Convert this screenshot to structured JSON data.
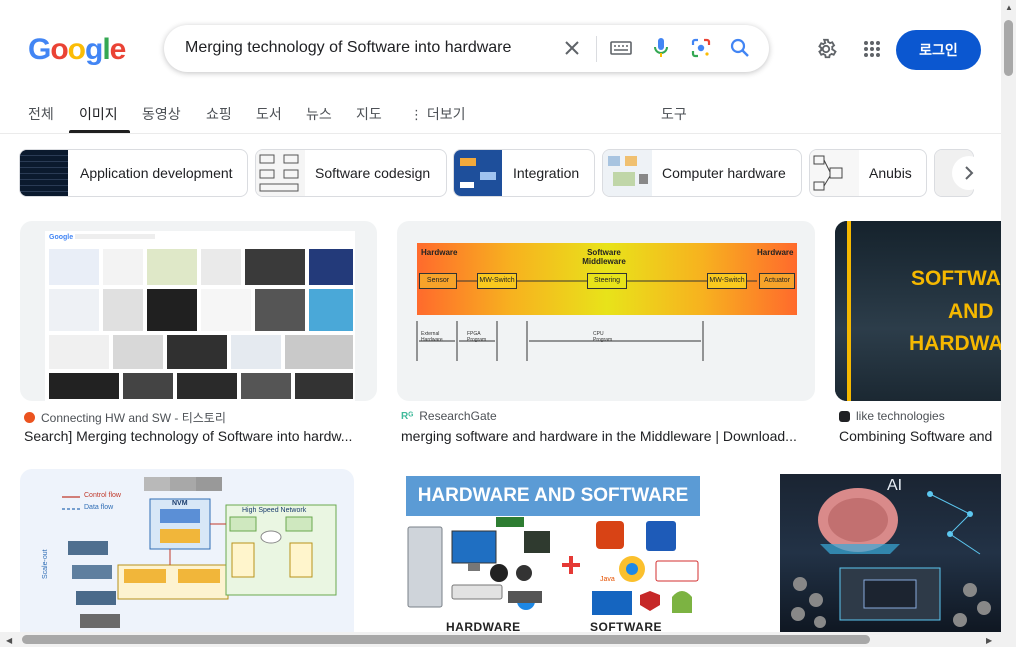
{
  "logo": {
    "text": "Google",
    "letters": [
      "G",
      "o",
      "o",
      "g",
      "l",
      "e"
    ],
    "colors": [
      "#4285F4",
      "#EA4335",
      "#FBBC05",
      "#4285F4",
      "#34A853",
      "#EA4335"
    ]
  },
  "search": {
    "query": "Merging technology of Software into hardware"
  },
  "header": {
    "login_label": "로그인"
  },
  "tabs": [
    {
      "label": "전체"
    },
    {
      "label": "이미지"
    },
    {
      "label": "동영상"
    },
    {
      "label": "쇼핑"
    },
    {
      "label": "도서"
    },
    {
      "label": "뉴스"
    },
    {
      "label": "지도"
    },
    {
      "label": "더보기"
    },
    {
      "label": "도구"
    }
  ],
  "chips": [
    {
      "label": "Application development"
    },
    {
      "label": "Software codesign"
    },
    {
      "label": "Integration"
    },
    {
      "label": "Computer hardware"
    },
    {
      "label": "Anubis"
    }
  ],
  "results": [
    {
      "source": "Connecting HW and SW - 티스토리",
      "title": "Search] Merging technology of Software into hardw...",
      "favicon_color": "#eb531f"
    },
    {
      "source": "ResearchGate",
      "title": "merging software and hardware in the Middleware | Download...",
      "favicon_color": "#40ba9b"
    },
    {
      "source": "like technologies",
      "title": "Combining Software and",
      "favicon_color": "#202124"
    }
  ],
  "images": {
    "middleware": {
      "left_label": "Hardware",
      "center_label": "Software Middleware",
      "right_label": "Hardware",
      "boxes": [
        "Sensor",
        "MW-Switch",
        "Steering",
        "MW-Switch",
        "Actuator"
      ],
      "bottom_labels": [
        "External Hardware",
        "FPGA Program",
        "CPU Program"
      ]
    },
    "likes": {
      "line1": "SOFTWA",
      "line2": "AND",
      "line3": "HARDWA"
    },
    "hw_sw": {
      "banner": "HARDWARE AND SOFTWARE",
      "left": "HARDWARE",
      "right": "SOFTWARE"
    },
    "ai": {
      "tag": "AI"
    },
    "arch": {
      "legend1": "Control flow",
      "legend2": "Data flow",
      "nvm": "NVM",
      "net": "High Speed Network",
      "scaleout": "Scale-out"
    }
  }
}
